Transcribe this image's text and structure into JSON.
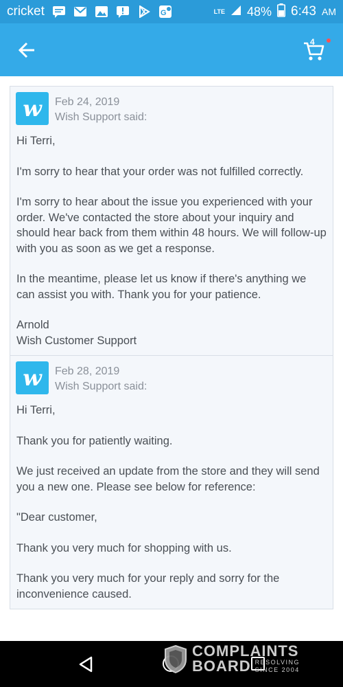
{
  "status_bar": {
    "carrier": "cricket",
    "network": "LTE",
    "battery": "48%",
    "time": "6:43",
    "ampm": "AM",
    "notification_icons": [
      "message-icon",
      "gmail-icon",
      "gallery-icon",
      "alert-icon",
      "play-store-icon",
      "maps-icon"
    ]
  },
  "app_bar": {
    "cart_count": "4",
    "accent": "#34aae8"
  },
  "messages": [
    {
      "date": "Feb 24, 2019",
      "author": "Wish Support said:",
      "paragraphs": [
        "Hi Terri,",
        "I'm sorry to hear that your order was not fulfilled correctly.",
        "I'm sorry to hear about the issue you experienced with your order. We've contacted the store about your inquiry and should hear back from them within 48 hours. We will follow-up with you as soon as we get a response.",
        "In the meantime, please let us know if there's anything we can assist you with. Thank you for your patience.",
        "Arnold\nWish Customer Support"
      ]
    },
    {
      "date": "Feb 28, 2019",
      "author": "Wish Support said:",
      "paragraphs": [
        "Hi Terri,",
        "Thank you for patiently waiting.",
        "We just received an update from the store and they will send you a new one. Please see below for reference:",
        "\"Dear customer,",
        "Thank you very much for shopping with us.",
        "Thank you very much for your reply and sorry for the inconvenience caused."
      ]
    }
  ],
  "watermark": {
    "line1": "COMPLAINTS",
    "line2": "BOARD",
    "tag1": "RESOLVING",
    "tag2": "SINCE 2004"
  }
}
